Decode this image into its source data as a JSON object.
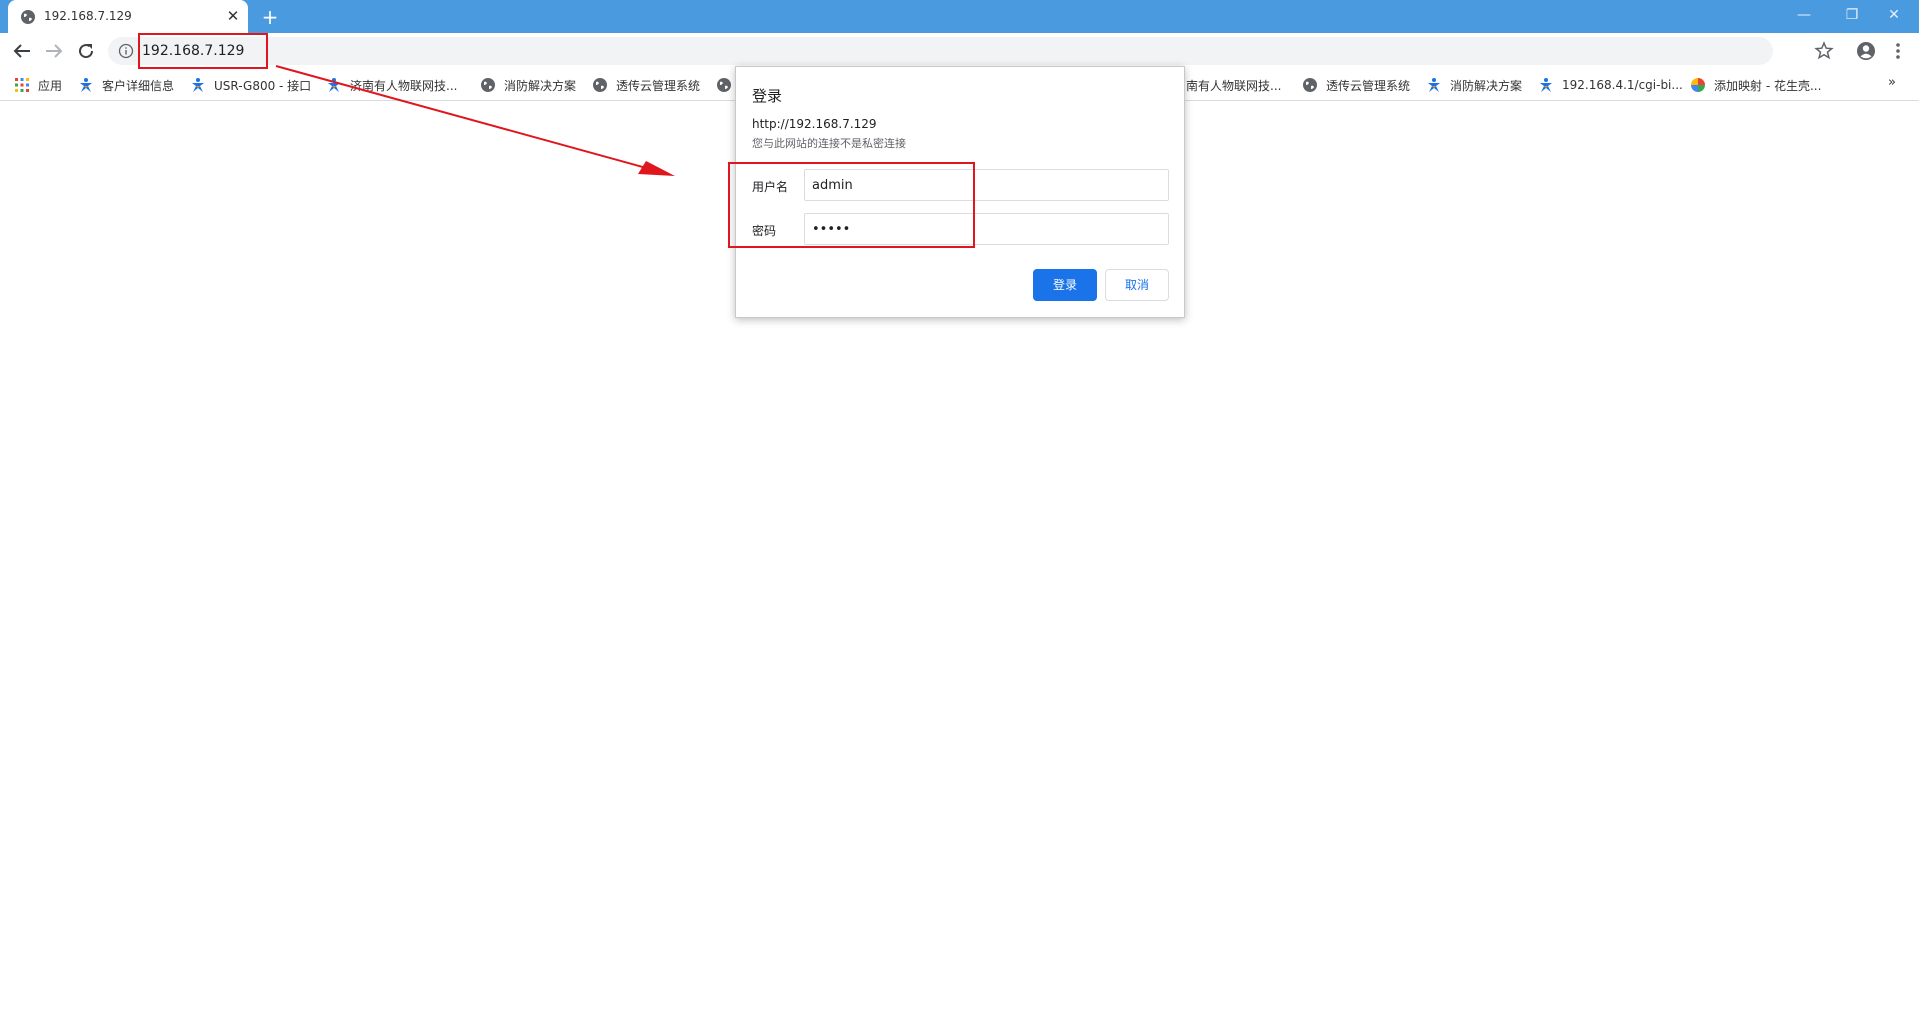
{
  "tab": {
    "title": "192.168.7.129",
    "close_glyph": "✕",
    "new_tab_glyph": "+"
  },
  "window_controls": {
    "minimize": "—",
    "restore": "❐",
    "close": "✕"
  },
  "toolbar": {
    "url": "192.168.7.129"
  },
  "bookmarks": [
    {
      "label": "应用",
      "icon": "apps-grid-icon"
    },
    {
      "label": "客户详细信息",
      "icon": "usr-logo-icon"
    },
    {
      "label": "USR-G800 - 接口",
      "icon": "usr-logo-icon"
    },
    {
      "label": "济南有人物联网技...",
      "icon": "usr-logo-icon"
    },
    {
      "label": "消防解决方案",
      "icon": "globe-icon"
    },
    {
      "label": "透传云管理系统",
      "icon": "globe-icon"
    },
    {
      "label": "",
      "icon": "globe-icon"
    },
    {
      "label": "南有人物联网技...",
      "icon": ""
    },
    {
      "label": "透传云管理系统",
      "icon": "globe-icon"
    },
    {
      "label": "消防解决方案",
      "icon": "usr-logo-icon"
    },
    {
      "label": "192.168.4.1/cgi-bi...",
      "icon": "usr-logo-icon"
    },
    {
      "label": "添加映射 - 花生壳...",
      "icon": "colorful-ball-icon"
    }
  ],
  "bookmarks_more": "»",
  "dialog": {
    "title": "登录",
    "url": "http://192.168.7.129",
    "note": "您与此网站的连接不是私密连接",
    "username_label": "用户名",
    "username_value": "admin",
    "password_label": "密码",
    "password_value": "•••••",
    "login_button": "登录",
    "cancel_button": "取消"
  },
  "colors": {
    "tabstrip": "#4a9ae0",
    "accent": "#1a73e8",
    "annotation": "#e0161e"
  }
}
